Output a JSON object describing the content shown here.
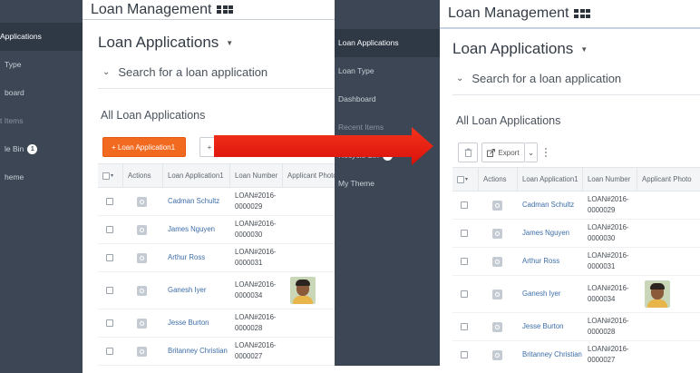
{
  "left": {
    "app_title": "Loan Management",
    "heading": "Loan Applications",
    "search_label": "Search for a loan application",
    "section_title": "All Loan Applications",
    "add_button_label": "+ Loan Application1",
    "sidebar": {
      "items": [
        "Applications",
        "Type",
        "board",
        "t Items",
        "le Bin",
        "heme"
      ],
      "badge": "1"
    }
  },
  "right": {
    "app_title": "Loan Management",
    "heading": "Loan Applications",
    "search_label": "Search for a loan application",
    "section_title": "All Loan Applications",
    "export_label": "Export",
    "sidebar": {
      "items": [
        "Loan Applications",
        "Loan Type",
        "Dashboard",
        "Recent Items",
        "Recycle Bin",
        "My Theme"
      ],
      "badge": "1"
    }
  },
  "table": {
    "columns": [
      "Actions",
      "Loan Application1",
      "Loan Number",
      "Applicant Photo"
    ],
    "left_photo_header": "Applicant Photo",
    "rows": [
      {
        "name": "Cadman Schultz",
        "loan_line1": "LOAN#2016-",
        "loan_line2": "0000029",
        "photo": false
      },
      {
        "name": "James Nguyen",
        "loan_line1": "LOAN#2016-",
        "loan_line2": "0000030",
        "photo": false
      },
      {
        "name": "Arthur Ross",
        "loan_line1": "LOAN#2016-",
        "loan_line2": "0000031",
        "photo": false
      },
      {
        "name": "Ganesh Iyer",
        "loan_line1": "LOAN#2016-",
        "loan_line2": "0000034",
        "photo": true
      },
      {
        "name": "Jesse Burton",
        "loan_line1": "LOAN#2016-",
        "loan_line2": "0000028",
        "photo": false
      },
      {
        "name": "Britanney Christian",
        "loan_line1": "LOAN#2016-",
        "loan_line2": "0000027",
        "photo": false
      }
    ]
  },
  "colors": {
    "sidebar": "#3c4654",
    "accent_orange": "#f26a1f",
    "link_blue": "#3d6ea8",
    "arrow_red": "#e8170b"
  },
  "icons": {
    "apps": "grid-icon",
    "caret": "caret-down-icon",
    "chevron": "chevron-down-icon",
    "trash": "trash-icon",
    "export": "export-icon",
    "more": "more-vertical-icon",
    "arrow": "right-arrow-icon"
  }
}
